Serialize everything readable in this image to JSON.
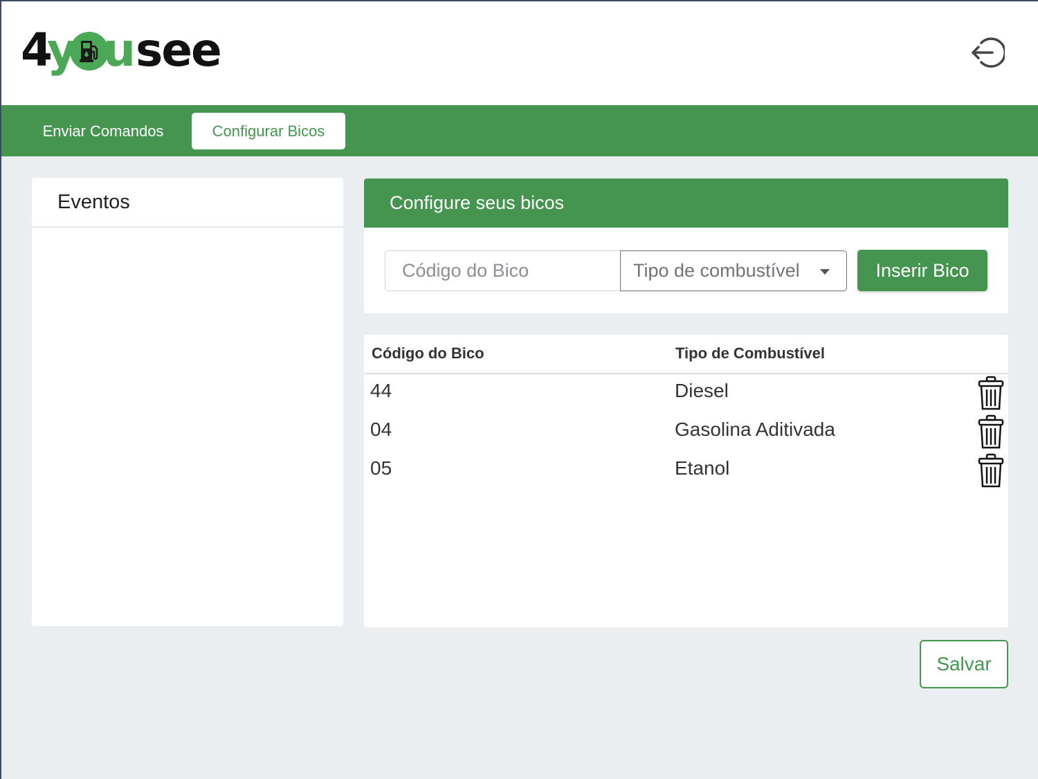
{
  "brand": {
    "logo_4": "4",
    "logo_y": "y",
    "logo_u": "u",
    "logo_see": "see",
    "logo_icon": "fuel-pump-icon",
    "primary_color": "#459550"
  },
  "header": {
    "logout_icon": "logout-icon"
  },
  "nav": {
    "tabs": [
      {
        "label": "Enviar Comandos",
        "active": false
      },
      {
        "label": "Configurar Bicos",
        "active": true
      }
    ]
  },
  "events": {
    "title": "Eventos"
  },
  "config": {
    "title": "Configure seus bicos",
    "code_placeholder": "Código do Bico",
    "code_value": "",
    "fuel_select_value": "Tipo de combustível",
    "insert_label": "Inserir Bico"
  },
  "table": {
    "headers": [
      "Código do Bico",
      "Tipo de Combustível"
    ],
    "rows": [
      {
        "code": "44",
        "fuel": "Diesel"
      },
      {
        "code": "04",
        "fuel": "Gasolina Aditivada"
      },
      {
        "code": "05",
        "fuel": "Etanol"
      }
    ],
    "row_action_icon": "trash-icon"
  },
  "footer": {
    "save_label": "Salvar"
  }
}
